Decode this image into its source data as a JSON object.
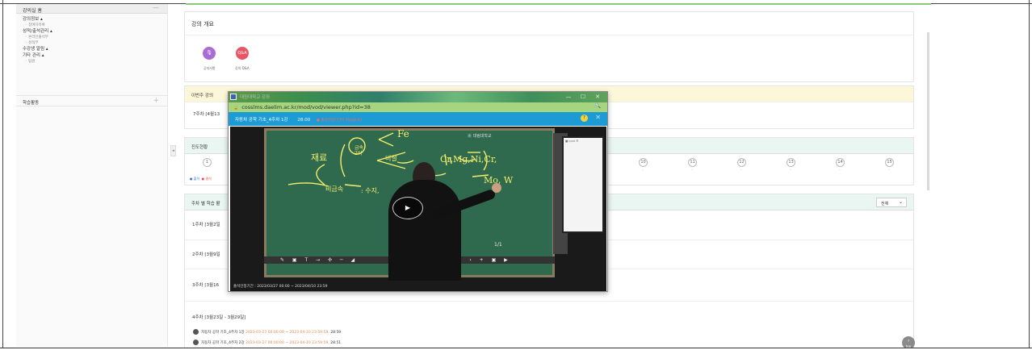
{
  "sidebar": {
    "title": "강의실 홈",
    "collapse_symbol": "—",
    "items": [
      {
        "type": "cat",
        "label": "강의정보 ▴"
      },
      {
        "type": "sub",
        "label": "◦ 참여자목록"
      },
      {
        "type": "cat",
        "label": "성적/출석관리 ▴"
      },
      {
        "type": "sub",
        "label": "◦ 온라인출석부"
      },
      {
        "type": "sub",
        "label": "◦ 성적부"
      },
      {
        "type": "cat",
        "label": "수강생 알림 ▴"
      },
      {
        "type": "cat",
        "label": "기타 관리 ▴"
      },
      {
        "type": "sub",
        "label": "◦ 팀원"
      }
    ],
    "activity_label": "학습활동",
    "activity_symbol": "+",
    "collapse_tab": "◂"
  },
  "overview": {
    "title": "강의 개요",
    "notice_label": "공지사항",
    "qa_button": "Q&A",
    "qa_label": "강의 Q&A"
  },
  "this_week": {
    "title": "이번주 강의",
    "row": "7주차 [4월13"
  },
  "progress": {
    "title": "진도현황",
    "weeks": [
      "1",
      "10",
      "11",
      "12",
      "13",
      "14",
      "15"
    ],
    "week_placeholder": "-",
    "legend_attend": "● 출석",
    "legend_absent": "● 결석"
  },
  "weekly": {
    "title": "주차 별 학습 활",
    "filter_value": "전체",
    "filter_arrow": "⌄",
    "rows": [
      "1주차 [3월2일",
      "2주차 [3월9일",
      "3주차 [3월16"
    ],
    "week4_title": "4주차 [3월23일 - 3월29일]",
    "lectures": [
      {
        "title": "자동차 공학 기초_4주차 1강",
        "period": "2023-03-27 00:00:00 ~ 2023-04-10 23:59:59,",
        "duration": "28:59"
      },
      {
        "title": "자동차 공학 기초_4주차 2강",
        "period": "2023-03-27 00:00:00 ~ 2023-04-10 23:59:59,",
        "duration": "28:51"
      }
    ]
  },
  "scroll_top": {
    "arrow": "↑",
    "label": "top"
  },
  "popup": {
    "window_title": "대림대학교 강좌",
    "controls": {
      "minimize": "—",
      "maximize": "☐",
      "close": "✕"
    },
    "url": "cosslms.daelim.ac.kr/mod/vod/viewer.php?id=38",
    "video_title": "자동차 공학 기초_4주차 1강",
    "video_time": "28:00",
    "notice": "● 출석인정기간이 지났습니다",
    "help": "?",
    "close": "✕",
    "board_logo": "㊌ 대림대학교",
    "page_indicator": "1/1",
    "toolbar_icons": "✎ ▣ T → ✣ ─ ◢",
    "toolbar_right": "‹ › + ▣ ▶",
    "play_symbol": "▶",
    "monitor_text": "■ ipad ☰",
    "footer": "출석인정기간 : 2023/03/27 00:00 ~ 2023/04/10 23:59"
  }
}
